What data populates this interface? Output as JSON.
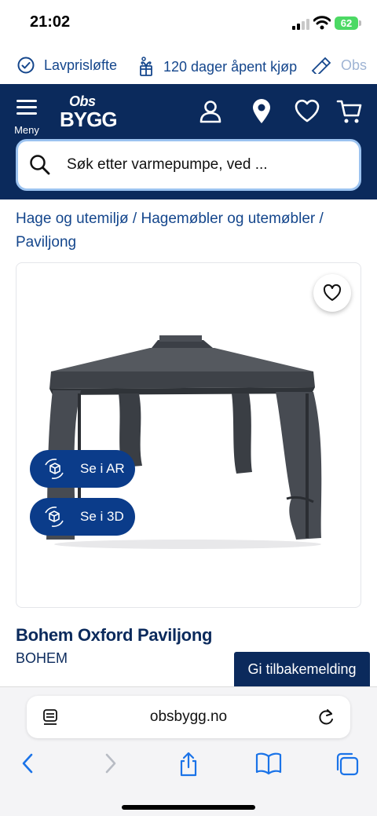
{
  "status": {
    "time": "21:02",
    "battery": "62"
  },
  "usps": [
    {
      "label": "Lavprisløfte",
      "icon": "check-circle-icon"
    },
    {
      "label": "120 dager åpent kjøp",
      "icon": "gift-box-icon"
    },
    {
      "label": "Obs",
      "icon": "tools-icon"
    }
  ],
  "header": {
    "menu_label": "Meny",
    "logo_top": "Obs",
    "logo_bottom": "BYGG",
    "icons": [
      "account-icon",
      "location-pin-icon",
      "heart-icon",
      "cart-icon"
    ]
  },
  "search": {
    "placeholder": "Søk etter varmepumpe, ved ..."
  },
  "breadcrumb": {
    "items": [
      "Hage og utemiljø",
      "Hagemøbler og utemøbler",
      "Paviljong"
    ],
    "separator": "/"
  },
  "product": {
    "ar_label": "Se i AR",
    "view3d_label": "Se i 3D",
    "title": "Bohem Oxford Paviljong",
    "brand": "BOHEM"
  },
  "feedback": {
    "label": "Gi tilbakemelding"
  },
  "browser": {
    "url": "obsbygg.no"
  },
  "colors": {
    "brand_navy": "#0b2a5c",
    "accent_blue": "#0b3c8a",
    "search_border": "#9cc3f0",
    "link_blue": "#14468c"
  }
}
